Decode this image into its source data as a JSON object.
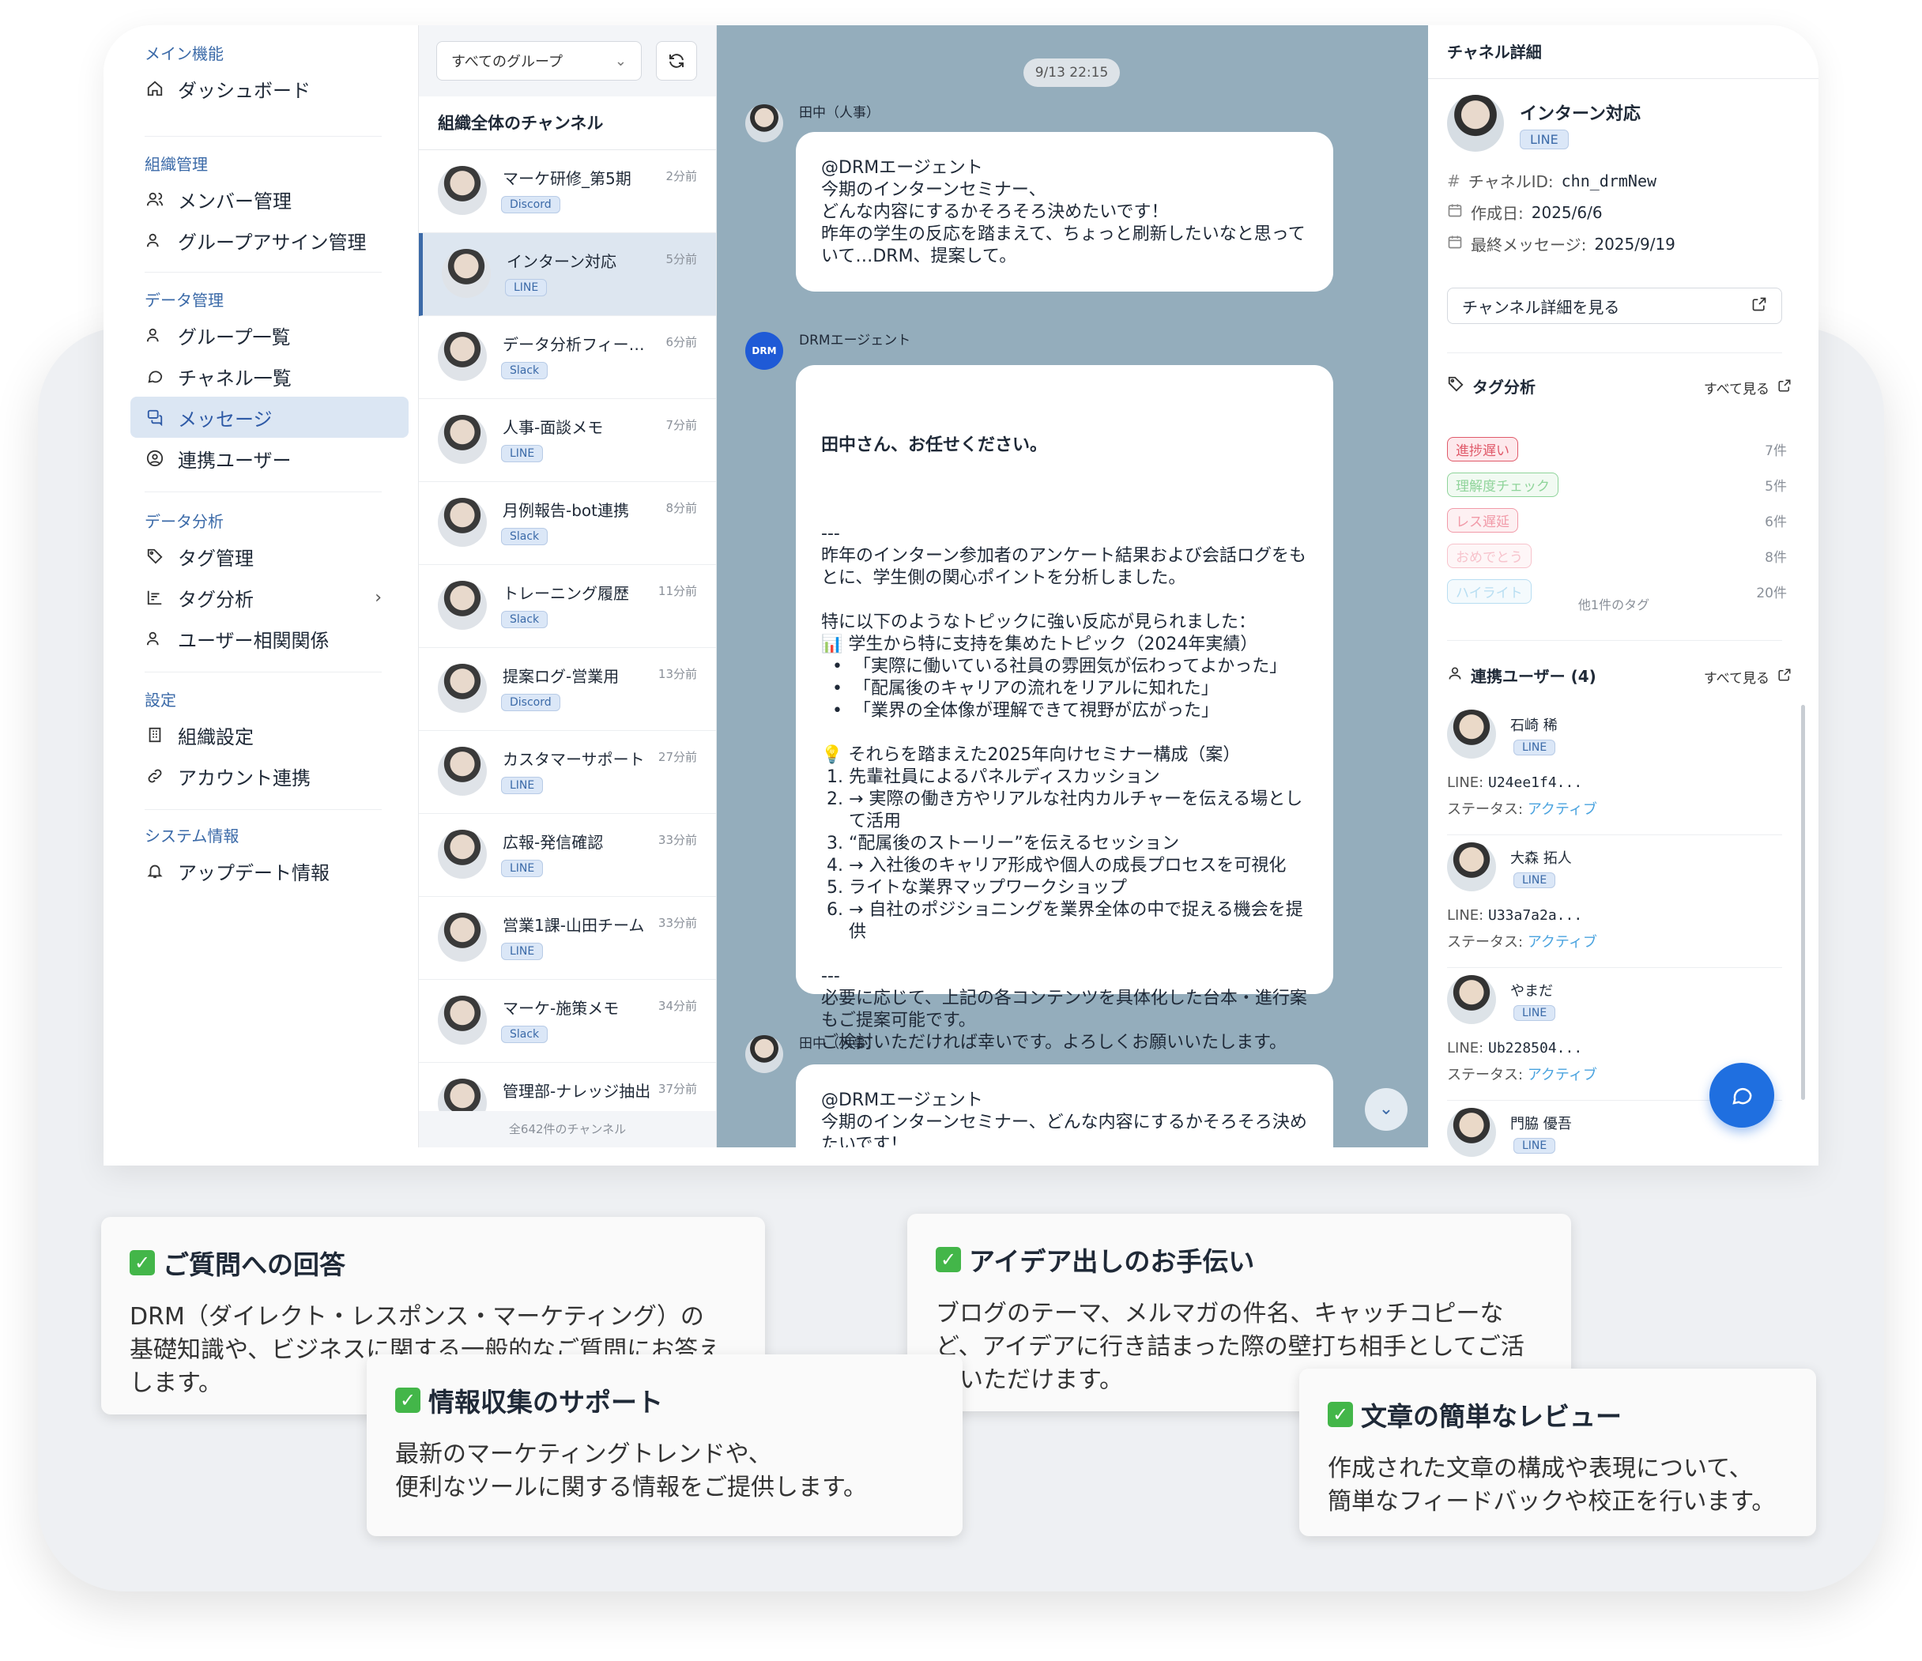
{
  "sidebar": {
    "sections": [
      {
        "heading": "メイン機能",
        "items": [
          "ダッシュボード"
        ]
      },
      {
        "heading": "組織管理",
        "items": [
          "メンバー管理",
          "グループアサイン管理"
        ]
      },
      {
        "heading": "データ管理",
        "items": [
          "グループ一覧",
          "チャネル一覧",
          "メッセージ",
          "連携ユーザー"
        ]
      },
      {
        "heading": "データ分析",
        "items": [
          "タグ管理",
          "タグ分析",
          "ユーザー相関関係"
        ]
      },
      {
        "heading": "設定",
        "items": [
          "組織設定",
          "アカウント連携"
        ]
      },
      {
        "heading": "システム情報",
        "items": [
          "アップデート情報"
        ]
      }
    ],
    "active": "メッセージ"
  },
  "channel_list": {
    "group_select": "すべてのグループ",
    "heading": "組織全体のチャンネル",
    "items": [
      {
        "name": "マーケ研修_第5期",
        "time": "2分前",
        "platform": "Discord"
      },
      {
        "name": "インターン対応",
        "time": "5分前",
        "platform": "LINE"
      },
      {
        "name": "データ分析フィー…",
        "time": "6分前",
        "platform": "Slack"
      },
      {
        "name": "人事-面談メモ",
        "time": "7分前",
        "platform": "LINE"
      },
      {
        "name": "月例報告-bot連携",
        "time": "8分前",
        "platform": "Slack"
      },
      {
        "name": "トレーニング履歴",
        "time": "11分前",
        "platform": "Slack"
      },
      {
        "name": "提案ログ-営業用",
        "time": "13分前",
        "platform": "Discord"
      },
      {
        "name": "カスタマーサポート",
        "time": "27分前",
        "platform": "LINE"
      },
      {
        "name": "広報-発信確認",
        "time": "33分前",
        "platform": "LINE"
      },
      {
        "name": "営業1課-山田チーム",
        "time": "33分前",
        "platform": "LINE"
      },
      {
        "name": "マーケ-施策メモ",
        "time": "34分前",
        "platform": "Slack"
      },
      {
        "name": "管理部-ナレッジ抽出",
        "time": "37分前",
        "platform": ""
      }
    ],
    "footer": "全642件のチャンネル"
  },
  "chat": {
    "date": "9/13 22:15",
    "messages": [
      {
        "sender": "田中（人事）",
        "text": "@DRMエージェント\n今期のインターンセミナー、\nどんな内容にするかそろそろ決めたいです！\n昨年の学生の反応を踏まえて、ちょっと刷新したいなと思って\nいて…DRM、提案して。"
      },
      {
        "sender": "DRMエージェント",
        "avatar": "DRM",
        "title": "田中さん、お任せください。",
        "text": "---\n昨年のインターン参加者のアンケート結果および会話ログをも\nとに、学生側の関心ポイントを分析しました。\n\n特に以下のようなトピックに強い反応が見られました：\n📊 学生から特に支持を集めたトピック（2024年実績）\n  •  「実際に働いている社員の雰囲気が伝わってよかった」\n  •  「配属後のキャリアの流れをリアルに知れた」\n  •  「業界の全体像が理解できて視野が広がった」\n\n💡 それらを踏まえた2025年向けセミナー構成（案）\n 1. 先輩社員によるパネルディスカッション\n 2. → 実際の働き方やリアルな社内カルチャーを伝える場とし\n     て活用\n 3. “配属後のストーリー”を伝えるセッション\n 4. → 入社後のキャリア形成や個人の成長プロセスを可視化\n 5. ライトな業界マップワークショップ\n 6. → 自社のポジショニングを業界全体の中で捉える機会を提\n     供\n\n---\n必要に応じて、上記の各コンテンツを具体化した台本・進行案\nもご提案可能です。\nご検討いただければ幸いです。よろしくお願いいたします。"
      },
      {
        "sender": "田中（人事）",
        "text": "@DRMエージェント\n今期のインターンセミナー、どんな内容にするかそろそろ決め\nたいです！"
      }
    ]
  },
  "details": {
    "heading": "チャネル詳細",
    "channel_name": "インターン対応",
    "platform": "LINE",
    "channel_id_label": "チャネルID:",
    "channel_id": "chn_drmNew",
    "created_label": "作成日:",
    "created": "2025/6/6",
    "last_msg_label": "最終メッセージ:",
    "last_msg": "2025/9/19",
    "view_button": "チャンネル詳細を見る",
    "tag_heading": "タグ分析",
    "see_all": "すべて見る",
    "tags": [
      {
        "name": "進捗遅い",
        "count": "7件",
        "color": "#e05a6a",
        "bg": "#fde9ec"
      },
      {
        "name": "理解度チェック",
        "count": "5件",
        "color": "#8fd49a",
        "bg": "#f1faf2"
      },
      {
        "name": "レス遅延",
        "count": "6件",
        "color": "#f19aa8",
        "bg": "#fdf0f2"
      },
      {
        "name": "おめでとう",
        "count": "8件",
        "color": "#f7c3cc",
        "bg": "#fef6f7"
      },
      {
        "name": "ハイライト",
        "count": "20件",
        "color": "#b8def2",
        "bg": "#f4fafd"
      }
    ],
    "tag_more": "他1件のタグ",
    "users_heading": "連携ユーザー (4)",
    "users": [
      {
        "name": "石崎 稀",
        "platform": "LINE",
        "line_label": "LINE:",
        "line_id": "U24ee1f4...",
        "status_label": "ステータス:",
        "status": "アクティブ"
      },
      {
        "name": "大森 拓人",
        "platform": "LINE",
        "line_label": "LINE:",
        "line_id": "U33a7a2a...",
        "status_label": "ステータス:",
        "status": "アクティブ"
      },
      {
        "name": "やまだ",
        "platform": "LINE",
        "line_label": "LINE:",
        "line_id": "Ub228504...",
        "status_label": "ステータス:",
        "status": "アクティブ"
      },
      {
        "name": "門脇 優吾",
        "platform": "LINE"
      }
    ]
  },
  "features": [
    {
      "title": "ご質問への回答",
      "body": "DRM（ダイレクト・レスポンス・マーケティング）の\n基礎知識や、ビジネスに関する一般的なご質問にお答え\nします。"
    },
    {
      "title": "アイデア出しのお手伝い",
      "body": "ブログのテーマ、メルマガの件名、キャッチコピーな\nど、アイデアに行き詰まった際の壁打ち相手としてご活\n用いただけます。"
    },
    {
      "title": "情報収集のサポート",
      "body": "最新のマーケティングトレンドや、\n便利なツールに関する情報をご提供します。"
    },
    {
      "title": "文章の簡単なレビュー",
      "body": "作成された文章の構成や表現について、\n簡単なフィードバックや校正を行います。"
    }
  ],
  "icons": {
    "check": "✅"
  }
}
